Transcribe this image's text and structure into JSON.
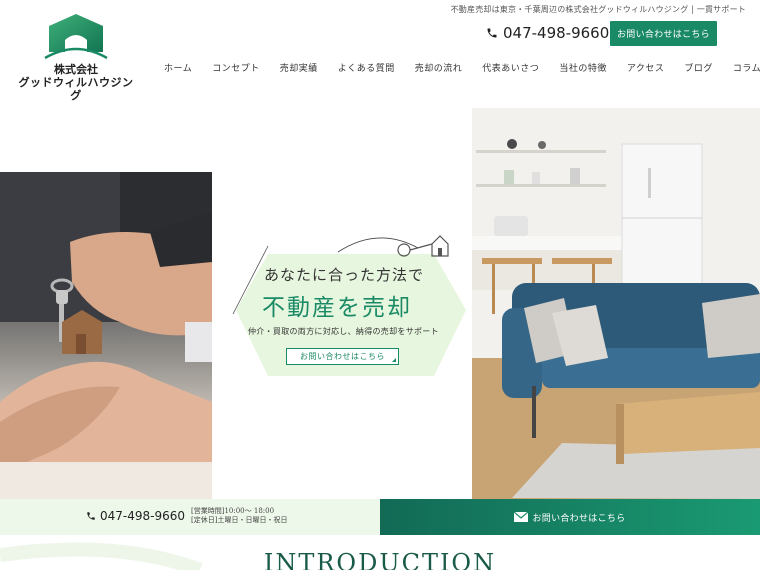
{
  "header": {
    "tagline": "不動産売却は東京・千葉周辺の株式会社グッドウィルハウジング | 一貫サポート",
    "phone": "047-498-9660",
    "contact_button": "お問い合わせはこちら",
    "logo": {
      "company": "株式会社",
      "name": "グッドウィルハウジング"
    }
  },
  "nav": {
    "items": [
      "ホーム",
      "コンセプト",
      "売却実績",
      "よくある質問",
      "売却の流れ",
      "代表あいさつ",
      "当社の特徴",
      "アクセス",
      "ブログ",
      "コラム"
    ]
  },
  "hero": {
    "line1": "あなたに合った方法で",
    "line2": "不動産を売却",
    "subline": "仲介・買取の両方に対応し、納得の売却をサポート",
    "button": "お問い合わせはこちら"
  },
  "contact_bar": {
    "phone": "047-498-9660",
    "hours_line1": "[営業時間]10:00～ 18:00",
    "hours_line2": "[定休日]土曜日・日曜日・祝日",
    "contact_button": "お問い合わせはこちら"
  },
  "intro": {
    "title": "INTRODUCTION"
  },
  "colors": {
    "brand_green": "#1a8a66",
    "bar_light": "#eef8ea",
    "hero_card": "#e6f5dc"
  },
  "icons": [
    "house-logo-icon",
    "phone-icon",
    "mail-icon",
    "key-house-icon"
  ]
}
